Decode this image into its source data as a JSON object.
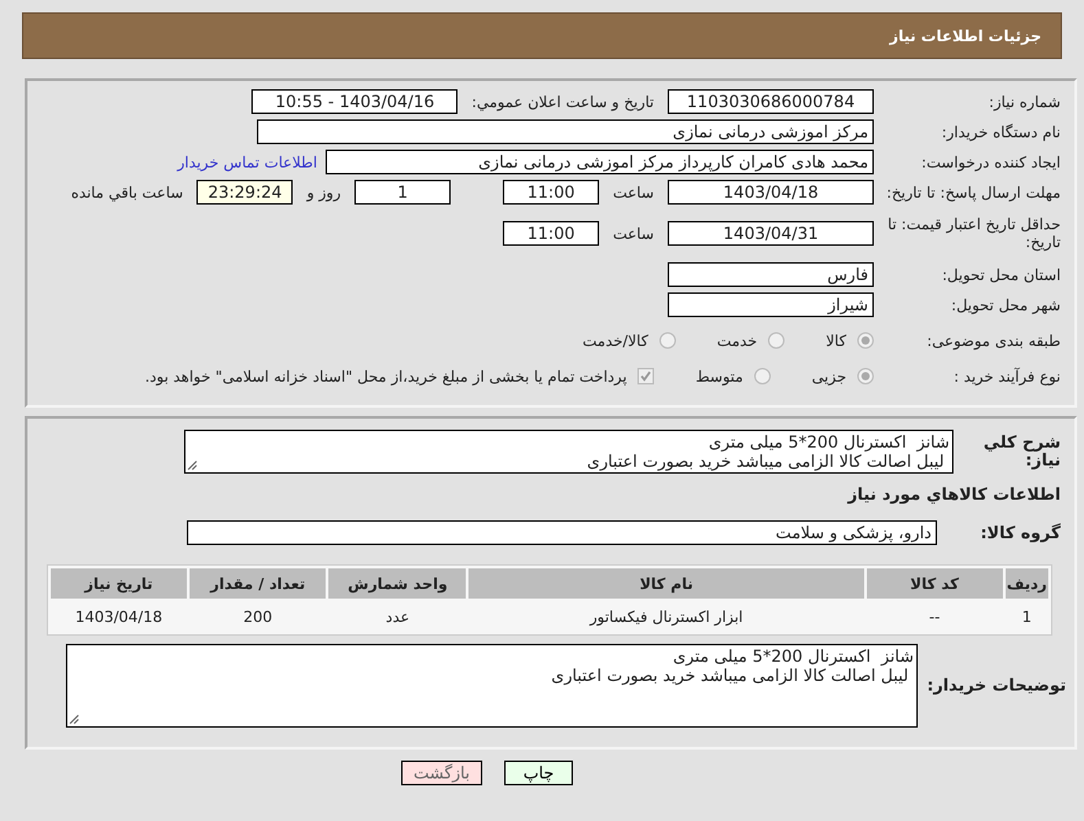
{
  "title": "جزئیات اطلاعات نیاز",
  "need_number": {
    "label": "شماره نیاز:",
    "value": "1103030686000784"
  },
  "announce": {
    "label": "تاریخ و ساعت اعلان عمومي:",
    "value": "1403/04/16 - 10:55"
  },
  "buyer": {
    "label": "نام دستگاه خریدار:",
    "value": "مرکز اموزشی درمانی نمازی"
  },
  "creator": {
    "label": "ایجاد کننده درخواست:",
    "value": "محمد هادی کامران کارپرداز مرکز اموزشی درمانی نمازی",
    "link": "اطلاعات تماس خریدار"
  },
  "deadline": {
    "label": "مهلت ارسال پاسخ: تا تاریخ:",
    "date": "1403/04/18",
    "time_label": "ساعت",
    "time": "11:00",
    "days": "1",
    "days_label": "روز و",
    "remaining": "23:29:24",
    "remaining_label": "ساعت باقي مانده"
  },
  "validity": {
    "label": "حداقل تاریخ اعتبار قیمت: تا تاریخ:",
    "date": "1403/04/31",
    "time_label": "ساعت",
    "time": "11:00"
  },
  "province": {
    "label": "استان محل تحویل:",
    "value": "فارس"
  },
  "city": {
    "label": "شهر محل تحویل:",
    "value": "شیراز"
  },
  "category": {
    "label": "طبقه بندی موضوعی:",
    "options": [
      {
        "label": "کالا",
        "selected": true
      },
      {
        "label": "خدمت",
        "selected": false
      },
      {
        "label": "کالا/خدمت",
        "selected": false
      }
    ]
  },
  "process": {
    "label": "نوع فرآیند خرید :",
    "options": [
      {
        "label": "جزیی",
        "selected": true
      },
      {
        "label": "متوسط",
        "selected": false
      }
    ],
    "treasury": {
      "checked": true,
      "text": "پرداخت تمام یا بخشی از مبلغ خرید،از محل \"اسناد خزانه اسلامی\" خواهد بود."
    }
  },
  "description": {
    "label": "شرح کلي نیاز:",
    "value": "شانز  اکسترنال 200*5 میلی متری\n لیبل اصالت کالا الزامی میباشد خرید بصورت اعتباری"
  },
  "goods_heading": "اطلاعات کالاهاي مورد نیاز",
  "goods_group": {
    "label": "گروه کالا:",
    "value": "دارو، پزشکی و سلامت"
  },
  "table": {
    "columns": [
      "ردیف",
      "کد کالا",
      "نام کالا",
      "واحد شمارش",
      "تعداد / مقدار",
      "تاریخ نیاز"
    ],
    "rows": [
      [
        "1",
        "--",
        "ابزار اکسترنال فیکساتور",
        "عدد",
        "200",
        "1403/04/18"
      ]
    ]
  },
  "buyer_notes": {
    "label": "توضیحات خریدار:",
    "value": "شانز  اکسترنال 200*5 میلی متری\n لیبل اصالت کالا الزامی میباشد خرید بصورت اعتباری"
  },
  "buttons": [
    {
      "label": "چاپ",
      "kind": "print"
    },
    {
      "label": "بازگشت",
      "kind": "back"
    }
  ]
}
